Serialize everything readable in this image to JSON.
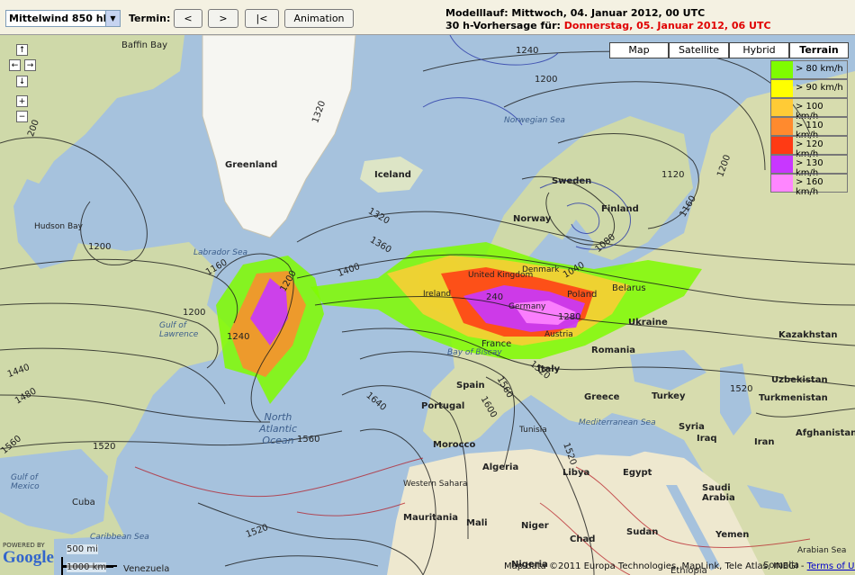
{
  "toolbar": {
    "level_select": "Mittelwind 850 hPa",
    "termin_label": "Termin:",
    "prev_button": "<",
    "next_button": ">",
    "first_button": "|<",
    "animation_button": "Animation",
    "run_line": "Modelllauf: Mittwoch, 04. Januar 2012, 00 UTC",
    "forecast_prefix": "30 h-Vorhersage für:",
    "forecast_date": "Donnerstag, 05. Januar 2012, 06 UTC"
  },
  "map": {
    "map_types": [
      {
        "label": "Map",
        "active": false
      },
      {
        "label": "Satellite",
        "active": false
      },
      {
        "label": "Hybrid",
        "active": false
      },
      {
        "label": "Terrain",
        "active": true
      }
    ],
    "legend": [
      {
        "label": "> 80 km/h",
        "color": "#7ffc00"
      },
      {
        "label": "> 90 km/h",
        "color": "#ffff00"
      },
      {
        "label": "> 100 km/h",
        "color": "#ffcb36"
      },
      {
        "label": "> 110 km/h",
        "color": "#ff8a2e"
      },
      {
        "label": "> 120 km/h",
        "color": "#ff3a14"
      },
      {
        "label": "> 130 km/h",
        "color": "#c837ff"
      },
      {
        "label": "> 160 km/h",
        "color": "#ff86ff"
      }
    ],
    "places": {
      "greenland": "Greenland",
      "iceland": "Iceland",
      "baffin": "Baffin Bay",
      "hudson": "Hudson Bay",
      "labrador": "Labrador Sea",
      "norway": "Norway",
      "sweden": "Sweden",
      "finland": "Finland",
      "norwegian_sea": "Norwegian Sea",
      "united_kingdom": "United Kingdom",
      "ireland": "Ireland",
      "france": "France",
      "spain": "Spain",
      "portugal": "Portugal",
      "italy": "Italy",
      "germany": "Germany",
      "poland": "Poland",
      "austria": "Austria",
      "denmark": "Denmark",
      "belarus": "Belarus",
      "ukraine": "Ukraine",
      "romania": "Romania",
      "greece": "Greece",
      "turkey": "Turkey",
      "kazakhstan": "Kazakhstan",
      "uzbekistan": "Uzbekistan",
      "turkmenistan": "Turkmenistan",
      "syria": "Syria",
      "iraq": "Iraq",
      "iran": "Iran",
      "afghanistan": "Afghanistan",
      "saudi_arabia": "Saudi Arabia",
      "egypt": "Egypt",
      "libya": "Libya",
      "algeria": "Algeria",
      "morocco": "Morocco",
      "tunisia": "Tunisia",
      "mali": "Mali",
      "niger": "Niger",
      "chad": "Chad",
      "sudan": "Sudan",
      "mauritania": "Mauritania",
      "western_sahara": "Western Sahara",
      "nigeria": "Nigeria",
      "yemen": "Yemen",
      "somalia": "Somalia",
      "ethiopia": "Ethiopia",
      "arabian_sea": "Arabian Sea",
      "north_atlantic": "North Atlantic Ocean",
      "gulf_mexico": "Gulf of Mexico",
      "caribbean": "Caribbean Sea",
      "cuba": "Cuba",
      "venezuela": "Venezuela",
      "bay_biscay": "Bay of Biscay",
      "mediterranean": "Mediterranean Sea",
      "gulf_lawrence": "Gulf of Lawrence"
    },
    "isolines": {
      "l1240a": "1240",
      "l1200a": "1200",
      "l1320a": "1320",
      "l1120": "1120",
      "l1160a": "1160",
      "l1200b": "1200",
      "l1200c": "1200",
      "l1360": "1360",
      "l1400": "1400",
      "l1160b": "1160",
      "l1200d": "1200",
      "l1240b": "1240",
      "l1040": "1040",
      "l1080": "1080",
      "l1280": "1280",
      "l1240c": "240",
      "l1560a": "1560",
      "l1520a": "1520",
      "l1640": "1640",
      "l1600": "1600",
      "l1560b": "1560",
      "l1520b": "1520",
      "l1320b": "1320",
      "l1520c": "1520",
      "l1440": "1440",
      "l1480": "1480",
      "l1560c": "1560",
      "l1200e": "200",
      "l1520d": "1520",
      "l1200f": "1200"
    },
    "scale_500": "500 mi",
    "scale_1000": "1000 km",
    "attribution": "Map data ©2011 Europa Technologies, MapLink, Tele Atlas, INEGI -",
    "terms": "Terms of Use",
    "google": "Google",
    "powered": "POWERED BY"
  }
}
